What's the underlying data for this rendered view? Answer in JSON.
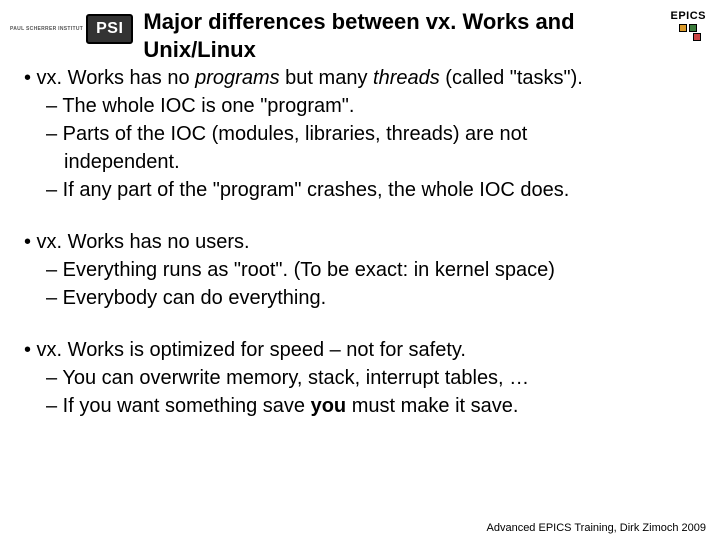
{
  "logo": {
    "institute_text": "PAUL SCHERRER INSTITUT",
    "psi_abbrev": "PSI"
  },
  "epics_label": "EPICS",
  "title_line1": "Major differences between vx. Works and",
  "title_line2": "Unix/Linux",
  "b1_pre": "• vx. Works has no ",
  "b1_it1": "programs",
  "b1_mid": " but many ",
  "b1_it2": "threads",
  "b1_post": " (called \"tasks\").",
  "b1_s1": "– The whole IOC is one \"program\".",
  "b1_s2a": "– Parts of the IOC (modules, libraries, threads) are not",
  "b1_s2b": "independent.",
  "b1_s3": "– If any part of the \"program\" crashes, the whole IOC does.",
  "b2": "• vx. Works has no users.",
  "b2_s1": "– Everything runs as \"root\". (To be exact: in kernel space)",
  "b2_s2": "– Everybody can do everything.",
  "b3": "• vx. Works is optimized for speed – not for safety.",
  "b3_s1": "– You can overwrite memory, stack, interrupt tables, …",
  "b3_s2a": "– If you want something save ",
  "b3_s2b": "you",
  "b3_s2c": " must make it save.",
  "footer": "Advanced EPICS Training, Dirk Zimoch 2009"
}
